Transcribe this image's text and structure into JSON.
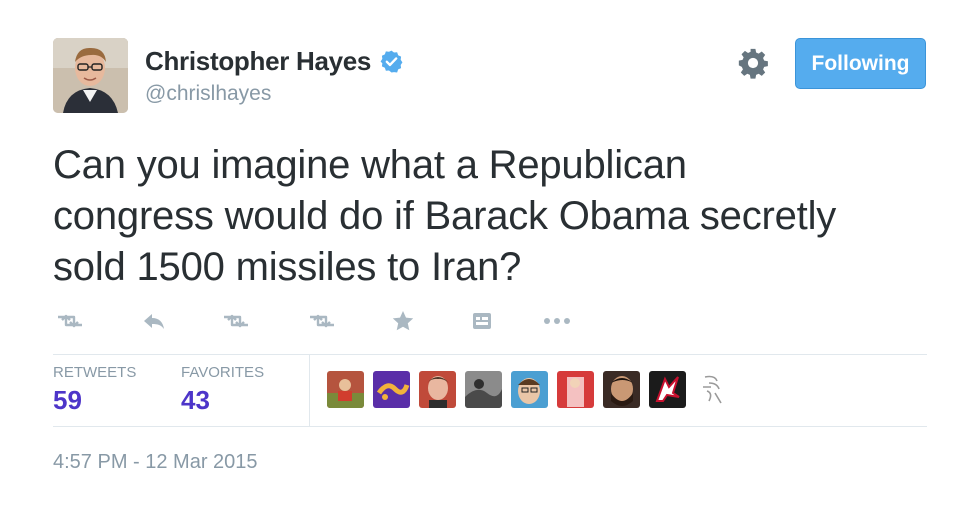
{
  "author": {
    "name": "Christopher Hayes",
    "handle": "@chrislhayes",
    "verified_icon": "verified-badge-icon",
    "avatar_icon": "author-avatar"
  },
  "header": {
    "settings_icon": "gear-icon",
    "follow_label": "Following"
  },
  "tweet": {
    "line1": "Can you imagine what a Republican",
    "line2": "congress would do if Barack Obama secretly",
    "line3": "sold 1500 missiles to Iran?"
  },
  "actions": [
    "retweet-icon",
    "reply-icon",
    "retweet-icon",
    "retweet-icon",
    "favorite-icon",
    "media-icon",
    "more-icon"
  ],
  "stats": {
    "retweets_label": "RETWEETS",
    "retweets_value": "59",
    "favorites_label": "FAVORITES",
    "favorites_value": "43"
  },
  "favoriters": [
    {
      "icon": "avatar",
      "color": "#b5543e"
    },
    {
      "icon": "avatar",
      "color": "#5a2ea8"
    },
    {
      "icon": "avatar",
      "color": "#c04a3a"
    },
    {
      "icon": "avatar",
      "color": "#6d6d6d"
    },
    {
      "icon": "avatar",
      "color": "#4b9fd2"
    },
    {
      "icon": "avatar",
      "color": "#d63b3b"
    },
    {
      "icon": "avatar",
      "color": "#3a2b25"
    },
    {
      "icon": "avatar",
      "color": "#1b1b1b"
    },
    {
      "icon": "avatar",
      "color": "#f0f0f0"
    }
  ],
  "timestamp": "4:57 PM - 12 Mar 2015",
  "colors": {
    "accent": "#55acee",
    "stat_value": "#4d35c9",
    "muted": "#8899a6"
  }
}
